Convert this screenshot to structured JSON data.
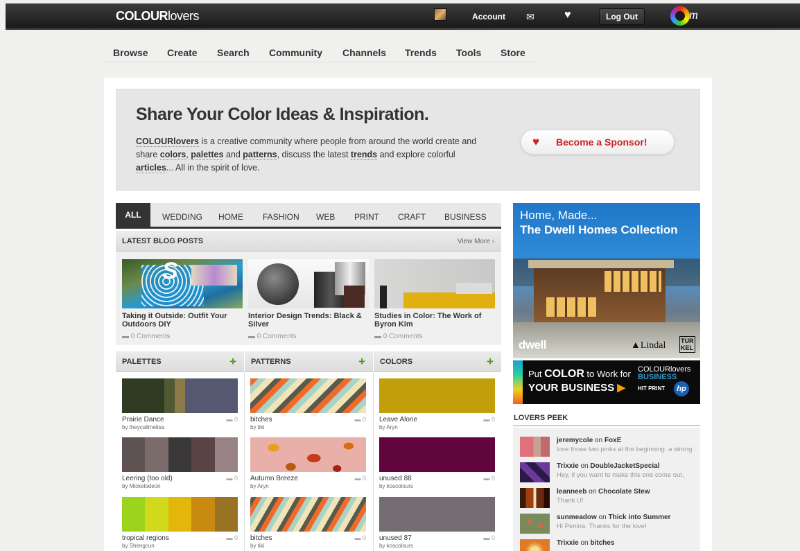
{
  "topbar": {
    "logo_bold": "COLOUR",
    "logo_light": "lovers",
    "account": "Account",
    "logout": "Log Out",
    "om": "m"
  },
  "nav": {
    "items": [
      "Browse",
      "Create",
      "Search",
      "Community",
      "Channels",
      "Trends",
      "Tools",
      "Store"
    ]
  },
  "hero": {
    "title": "Share Your Color Ideas & Inspiration.",
    "p1": "COLOURlovers",
    "p2": " is a creative community where people from around the world create and share ",
    "p3": "colors",
    "p4": ", ",
    "p5": "palettes",
    "p6": " and ",
    "p7": "patterns",
    "p8": ", discuss the latest ",
    "p9": "trends",
    "p10": " and explore colorful ",
    "p11": "articles",
    "p12": "... All in the spirit of love.",
    "sponsor": "Become a Sponsor!"
  },
  "tabs": [
    "ALL",
    "WEDDING",
    "HOME",
    "FASHION",
    "WEB",
    "PRINT",
    "CRAFT",
    "BUSINESS"
  ],
  "blog": {
    "header": "LATEST BLOG POSTS",
    "view_more": "View More ›",
    "posts": [
      {
        "title": "Taking it Outside: Outfit Your Outdoors DIY",
        "comments": "0 Comments"
      },
      {
        "title": "Interior Design Trends: Black & Silver",
        "comments": "0 Comments"
      },
      {
        "title": "Studies in Color: The Work of Byron Kim",
        "comments": "0 Comments"
      }
    ]
  },
  "columns": {
    "palettes": {
      "header": "PALETTES",
      "items": [
        {
          "name": "Prairie Dance",
          "by": "by theycallmelisa",
          "count": "0",
          "colors": [
            "#2f3b22",
            "#2f3b22",
            "#4f5a34",
            "#8a7a4a",
            "#555870",
            "#555870"
          ]
        },
        {
          "name": "Leering (too old)",
          "by": "by Mickelodeon",
          "count": "0",
          "colors": [
            "#5e5253",
            "#7b6b6b",
            "#3b3839",
            "#5a4345",
            "#988286"
          ]
        },
        {
          "name": "tropical regions",
          "by": "by Shengcun",
          "count": "0",
          "colors": [
            "#9bd31d",
            "#d2d81a",
            "#e3b60b",
            "#c88a10",
            "#987324"
          ]
        }
      ]
    },
    "patterns": {
      "header": "PATTERNS",
      "items": [
        {
          "name": "bitches",
          "by": "by tiki",
          "count": "0"
        },
        {
          "name": "Autumn Breeze",
          "by": "by Aryn",
          "count": "0"
        },
        {
          "name": "bitches",
          "by": "by tiki",
          "count": "0"
        }
      ]
    },
    "colors": {
      "header": "COLORS",
      "items": [
        {
          "name": "Leave Alone",
          "by": "by Aryn",
          "count": "0",
          "color": "#c09f0a"
        },
        {
          "name": "unused 88",
          "by": "by koscolours",
          "count": "0",
          "color": "#61053f"
        },
        {
          "name": "unused 87",
          "by": "by koscolours",
          "count": "0",
          "color": "#736c72"
        }
      ]
    }
  },
  "ads": {
    "dwell_line1": "Home, Made...",
    "dwell_line2": "The Dwell Homes Collection",
    "dwell_brand": "dwell",
    "lindal": "Lindal",
    "turkel_top": "TUR",
    "turkel_bottom": "KEL",
    "put": "Put ",
    "color": "COLOR",
    "to_work": " to Work for",
    "your_business": "YOUR BUSINESS",
    "cl": "COLOURlovers",
    "cl_business": "BUSINESS",
    "hit_print": "HIT PRINT",
    "hp": "hp"
  },
  "lovers_peek": {
    "header": "LOVERS PEEK",
    "on": " on ",
    "items": [
      {
        "user": "jeremycole",
        "target": "FoxE",
        "msg": "love those two pinks at the beginning. a strong"
      },
      {
        "user": "Trixxie",
        "target": "DoubleJacketSpecial",
        "msg": "Hey, if you want to make this one come out,"
      },
      {
        "user": "leanneeb",
        "target": "Chocolate Stew",
        "msg": "Thank U!"
      },
      {
        "user": "sunmeadow",
        "target": "Thick into Summer",
        "msg": "Hi Penina. Thanks for the love!"
      },
      {
        "user": "Trixxie",
        "target": "bitches",
        "msg": ""
      }
    ]
  }
}
